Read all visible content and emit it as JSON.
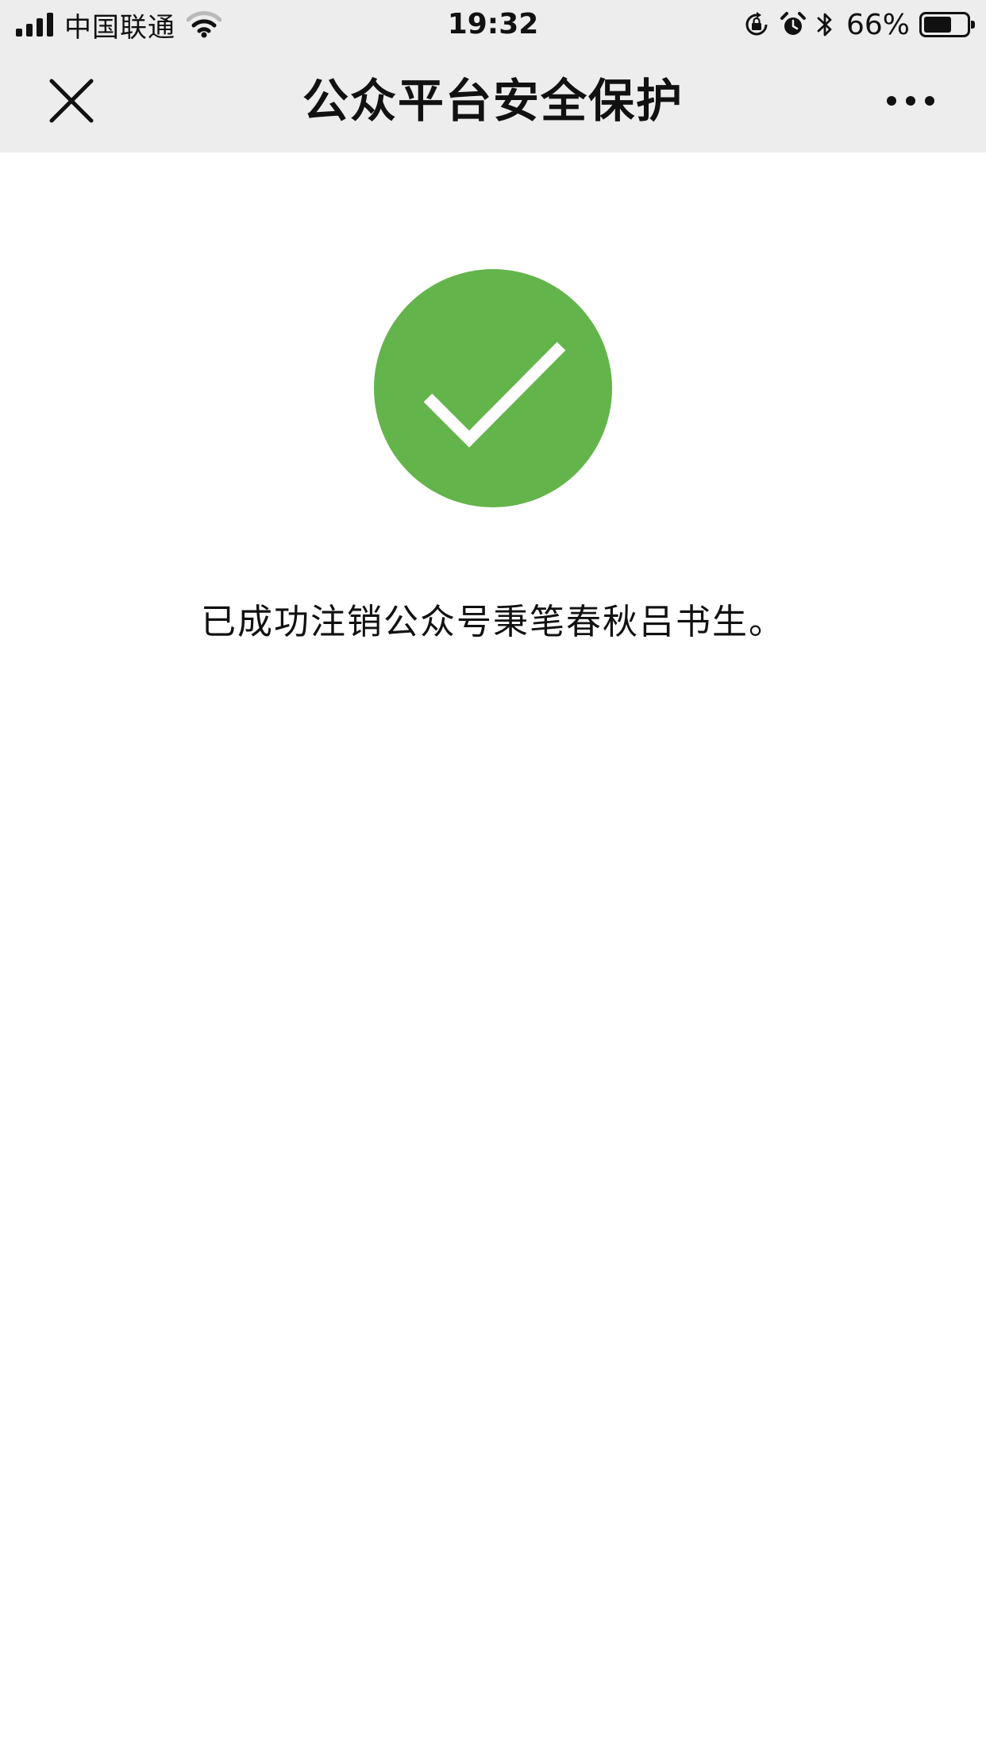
{
  "status_bar": {
    "carrier": "中国联通",
    "time": "19:32",
    "battery": "66%",
    "battery_level": 0.66,
    "icons": [
      "signal-icon",
      "wifi-icon",
      "rotation-lock-icon",
      "alarm-icon",
      "bluetooth-icon",
      "battery-icon"
    ]
  },
  "nav": {
    "title": "公众平台安全保护",
    "close_icon": "close-icon",
    "more_icon": "more-icon"
  },
  "result": {
    "icon": "success-check-icon",
    "accent_color": "#64b44c",
    "message": "已成功注销公众号秉笔春秋吕书生。"
  }
}
